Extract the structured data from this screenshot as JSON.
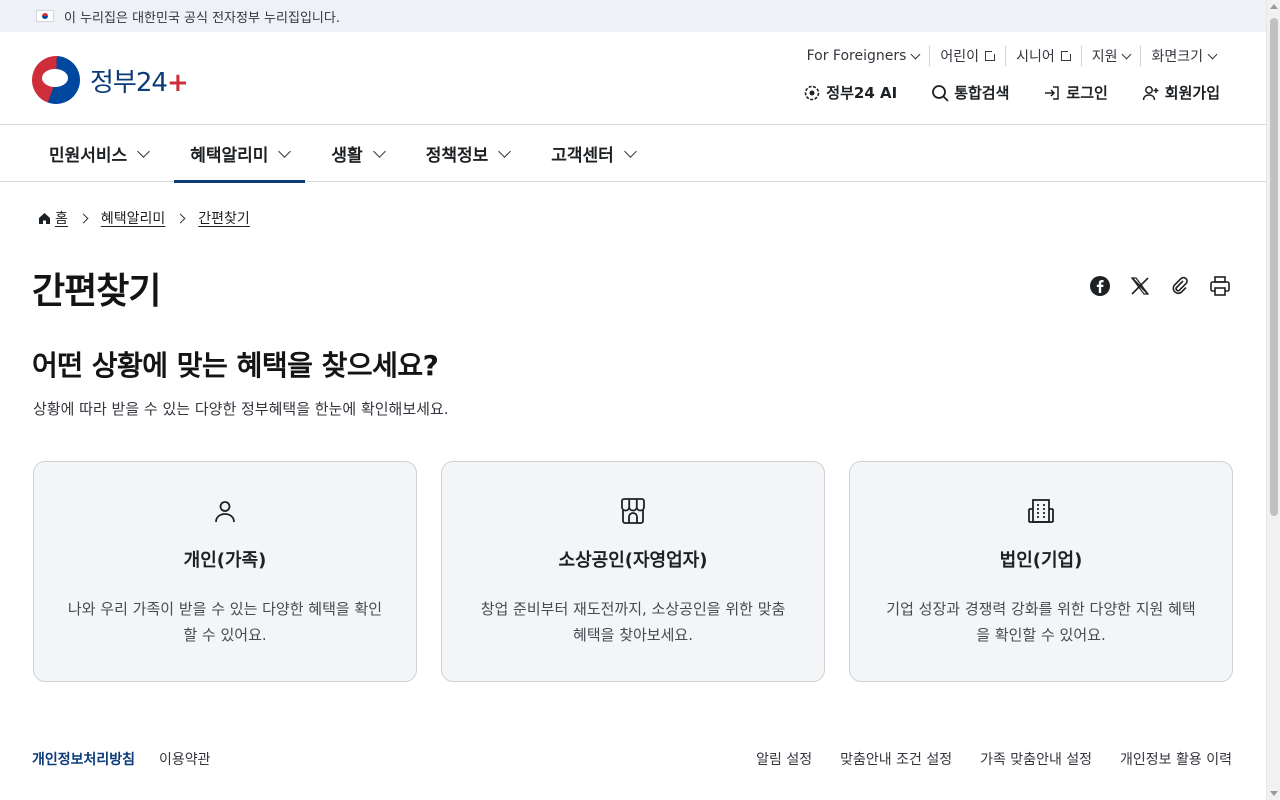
{
  "banner": {
    "text": "이 누리집은 대한민국 공식 전자정부 누리집입니다."
  },
  "logo": {
    "text": "정부24",
    "plus": "+"
  },
  "util_top": [
    {
      "label": "For Foreigners",
      "icon": "chevron-down-icon"
    },
    {
      "label": "어린이",
      "icon": "external-link-icon"
    },
    {
      "label": "시니어",
      "icon": "external-link-icon"
    },
    {
      "label": "지원",
      "icon": "chevron-down-icon"
    },
    {
      "label": "화면크기",
      "icon": "chevron-down-icon"
    }
  ],
  "util_main": [
    {
      "label": "정부24 AI",
      "icon": "ai-icon"
    },
    {
      "label": "통합검색",
      "icon": "search-icon"
    },
    {
      "label": "로그인",
      "icon": "login-icon"
    },
    {
      "label": "회원가입",
      "icon": "user-add-icon"
    }
  ],
  "gnb": [
    {
      "label": "민원서비스",
      "active": false
    },
    {
      "label": "혜택알리미",
      "active": true
    },
    {
      "label": "생활",
      "active": false
    },
    {
      "label": "정책정보",
      "active": false
    },
    {
      "label": "고객센터",
      "active": false
    }
  ],
  "breadcrumb": [
    "홈",
    "혜택알리미",
    "간편찾기"
  ],
  "page_title": "간편찾기",
  "share": [
    "facebook-icon",
    "x-icon",
    "link-icon",
    "print-icon"
  ],
  "section": {
    "title": "어떤 상황에 맞는 혜택을 찾으세요?",
    "desc": "상황에 따라 받을 수 있는 다양한 정부혜택을 한눈에 확인해보세요."
  },
  "cards": [
    {
      "title": "개인(가족)",
      "desc": "나와 우리 가족이 받을 수 있는 다양한 혜택을 확인할 수 있어요.",
      "icon": "person-icon"
    },
    {
      "title": "소상공인(자영업자)",
      "desc": "창업 준비부터 재도전까지, 소상공인을 위한 맞춤 혜택을 찾아보세요.",
      "icon": "store-icon"
    },
    {
      "title": "법인(기업)",
      "desc": "기업 성장과 경쟁력 강화를 위한 다양한 지원 혜택을 확인할 수 있어요.",
      "icon": "building-icon"
    }
  ],
  "footer": {
    "left": [
      "개인정보처리방침",
      "이용약관"
    ],
    "right": [
      "알림 설정",
      "맞춤안내 조건 설정",
      "가족 맞춤안내 설정",
      "개인정보 활용 이력"
    ]
  },
  "colors": {
    "brand": "#0b3b78",
    "accent_red": "#cd2e3a",
    "card_bg": "#f4f5f6"
  }
}
